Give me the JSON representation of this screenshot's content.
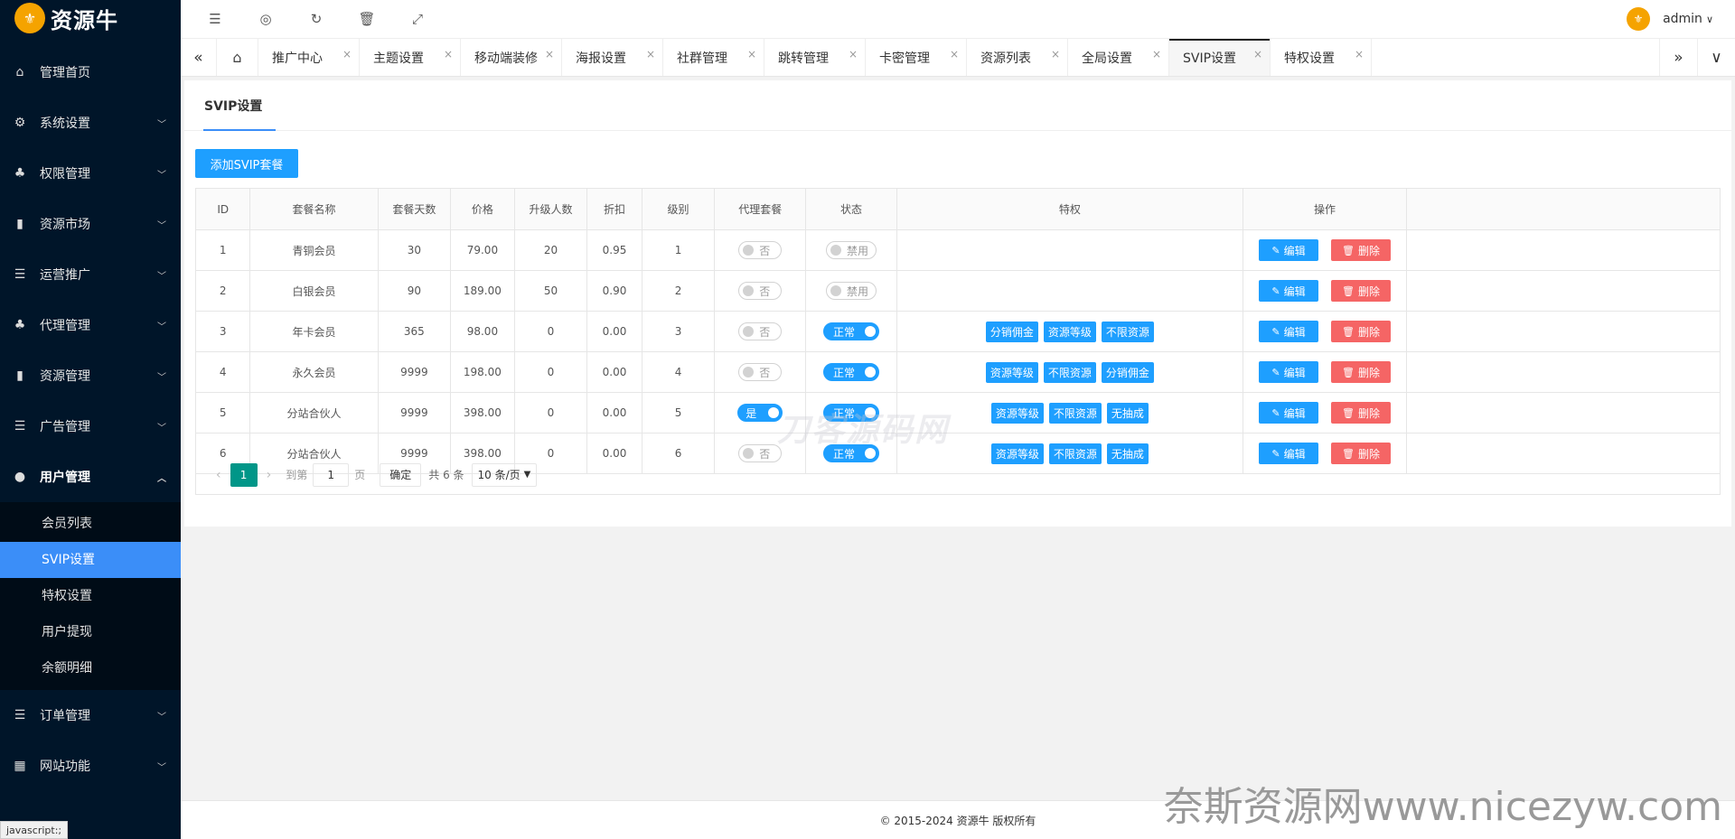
{
  "brand": {
    "name": "资源牛",
    "logo_glyph": "⚜"
  },
  "sidebar": {
    "items": [
      {
        "label": "管理首页",
        "icon": "home-icon",
        "glyph": "⌂",
        "expandable": false
      },
      {
        "label": "系统设置",
        "icon": "gear-icon",
        "glyph": "⚙",
        "expandable": true
      },
      {
        "label": "权限管理",
        "icon": "users-icon",
        "glyph": "♣",
        "expandable": true
      },
      {
        "label": "资源市场",
        "icon": "bookmark-icon",
        "glyph": "▮",
        "expandable": true
      },
      {
        "label": "运营推广",
        "icon": "list-icon",
        "glyph": "☰",
        "expandable": true
      },
      {
        "label": "代理管理",
        "icon": "group-icon",
        "glyph": "♣",
        "expandable": true
      },
      {
        "label": "资源管理",
        "icon": "bookmark-icon",
        "glyph": "▮",
        "expandable": true
      },
      {
        "label": "广告管理",
        "icon": "list-icon",
        "glyph": "☰",
        "expandable": true
      },
      {
        "label": "用户管理",
        "icon": "user-icon",
        "glyph": "●",
        "expandable": true,
        "open": true,
        "children": [
          "会员列表",
          "SVIP设置",
          "特权设置",
          "用户提现",
          "余额明细"
        ],
        "active_child": "SVIP设置"
      },
      {
        "label": "订单管理",
        "icon": "list-icon",
        "glyph": "☰",
        "expandable": true
      },
      {
        "label": "网站功能",
        "icon": "apps-icon",
        "glyph": "▦",
        "expandable": true
      }
    ]
  },
  "header": {
    "icons": [
      "menu-toggle-icon",
      "globe-icon",
      "refresh-icon",
      "trash-icon",
      "fullscreen-icon"
    ],
    "username": "admin"
  },
  "tabs": {
    "items": [
      "推广中心",
      "主题设置",
      "移动端装修",
      "海报设置",
      "社群管理",
      "跳转管理",
      "卡密管理",
      "资源列表",
      "全局设置",
      "SVIP设置",
      "特权设置"
    ],
    "active": "SVIP设置"
  },
  "page": {
    "tab_title": "SVIP设置",
    "add_button": "添加SVIP套餐"
  },
  "table": {
    "headers": [
      "ID",
      "套餐名称",
      "套餐天数",
      "价格",
      "升级人数",
      "折扣",
      "级别",
      "代理套餐",
      "状态",
      "特权",
      "操作"
    ],
    "rows": [
      {
        "id": "1",
        "name": "青铜会员",
        "days": "30",
        "price": "79.00",
        "upgrades": "20",
        "discount": "0.95",
        "level": "1",
        "agent": "否",
        "agent_on": false,
        "status": "禁用",
        "status_on": false,
        "perks": []
      },
      {
        "id": "2",
        "name": "白银会员",
        "days": "90",
        "price": "189.00",
        "upgrades": "50",
        "discount": "0.90",
        "level": "2",
        "agent": "否",
        "agent_on": false,
        "status": "禁用",
        "status_on": false,
        "perks": []
      },
      {
        "id": "3",
        "name": "年卡会员",
        "days": "365",
        "price": "98.00",
        "upgrades": "0",
        "discount": "0.00",
        "level": "3",
        "agent": "否",
        "agent_on": false,
        "status": "正常",
        "status_on": true,
        "perks": [
          "分销佣金",
          "资源等级",
          "不限资源"
        ]
      },
      {
        "id": "4",
        "name": "永久会员",
        "days": "9999",
        "price": "198.00",
        "upgrades": "0",
        "discount": "0.00",
        "level": "4",
        "agent": "否",
        "agent_on": false,
        "status": "正常",
        "status_on": true,
        "perks": [
          "资源等级",
          "不限资源",
          "分销佣金"
        ]
      },
      {
        "id": "5",
        "name": "分站合伙人",
        "days": "9999",
        "price": "398.00",
        "upgrades": "0",
        "discount": "0.00",
        "level": "5",
        "agent": "是",
        "agent_on": true,
        "status": "正常",
        "status_on": true,
        "perks": [
          "资源等级",
          "不限资源",
          "无抽成"
        ]
      },
      {
        "id": "6",
        "name": "分站合伙人",
        "days": "9999",
        "price": "398.00",
        "upgrades": "0",
        "discount": "0.00",
        "level": "6",
        "agent": "否",
        "agent_on": false,
        "status": "正常",
        "status_on": true,
        "perks": [
          "资源等级",
          "不限资源",
          "无抽成"
        ]
      }
    ],
    "edit_label": "编辑",
    "delete_label": "删除"
  },
  "pager": {
    "current": "1",
    "goto_label": "到第",
    "goto_value": "1",
    "page_label": "页",
    "confirm_label": "确定",
    "total": "共 6 条",
    "page_size": "10 条/页"
  },
  "footer": {
    "copyright": "© 2015-2024 资源牛 版权所有"
  },
  "watermark": {
    "text": "奈斯资源网www.nicezyw.com",
    "center_text": "刀客源码网"
  },
  "statusbar": {
    "text": "javascript:;"
  },
  "colors": {
    "sidebar_bg": "#001529",
    "accent": "#1e9fff",
    "active_menu": "#3b8ef8",
    "danger": "#f56565",
    "pager_active": "#009688"
  }
}
